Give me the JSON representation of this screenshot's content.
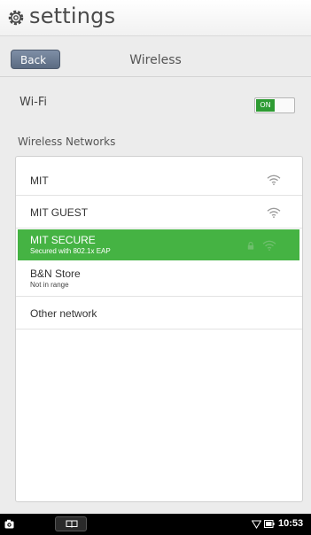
{
  "header": {
    "title": "settings",
    "icon": "gear-icon"
  },
  "toolbar": {
    "back_label": "Back",
    "page_title": "Wireless"
  },
  "wifi": {
    "label": "Wi-Fi",
    "toggle_label": "ON",
    "enabled": true
  },
  "networks": {
    "heading": "Wireless Networks",
    "items": [
      {
        "name": "MIT",
        "subtitle": "",
        "secured": false,
        "selected": false
      },
      {
        "name": "MIT GUEST",
        "subtitle": "",
        "secured": false,
        "selected": false
      },
      {
        "name": "MIT SECURE",
        "subtitle": "Secured with 802.1x EAP",
        "secured": true,
        "selected": true
      },
      {
        "name": "B&N Store",
        "subtitle": "Not in range",
        "secured": false,
        "selected": false
      },
      {
        "name": "Other network",
        "subtitle": "",
        "secured": false,
        "selected": false
      }
    ]
  },
  "status_bar": {
    "time": "10:53"
  },
  "colors": {
    "selected_row": "#45b343",
    "toggle_on": "#2e9b33",
    "back_button": "#6b7b92"
  }
}
